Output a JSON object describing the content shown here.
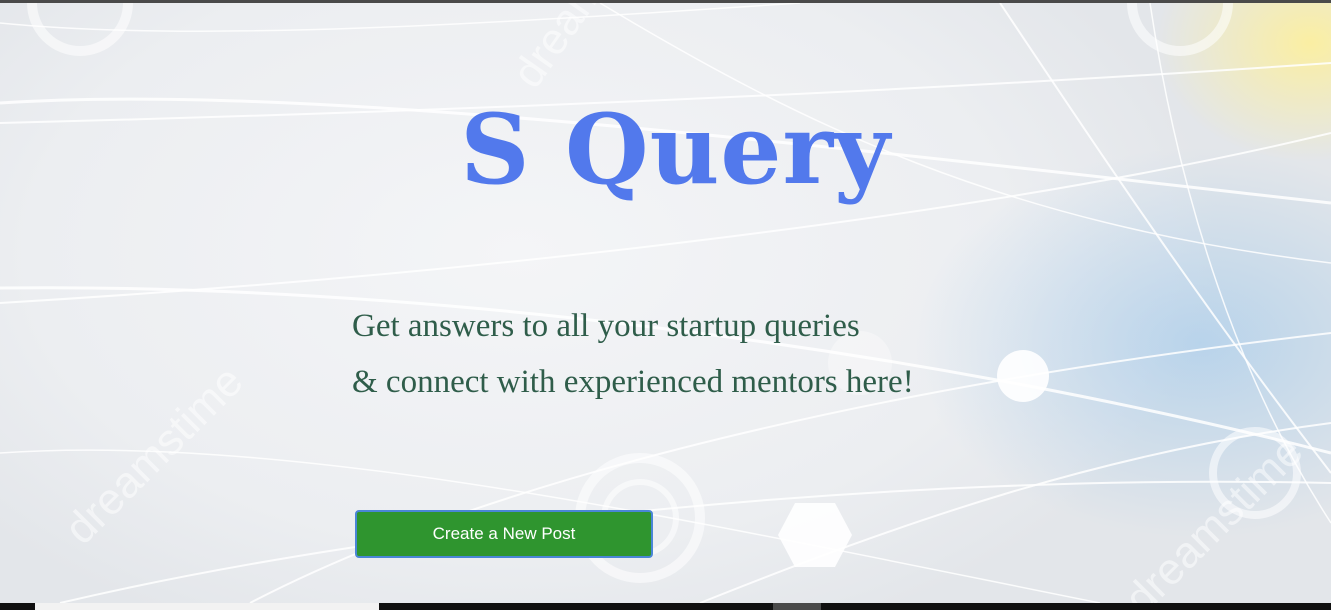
{
  "hero": {
    "title": "S Query",
    "tagline_line1": "Get answers to all your startup queries",
    "tagline_line2": "& connect with experienced mentors here!"
  },
  "actions": {
    "create_post_label": "Create a New Post"
  },
  "colors": {
    "title": "#5279ec",
    "tagline": "#2f5d4a",
    "button_bg": "#2f952f",
    "button_border": "#4a86d6",
    "button_text": "#ffffff"
  },
  "icons": {
    "background": "abstract-light-lines-background"
  }
}
